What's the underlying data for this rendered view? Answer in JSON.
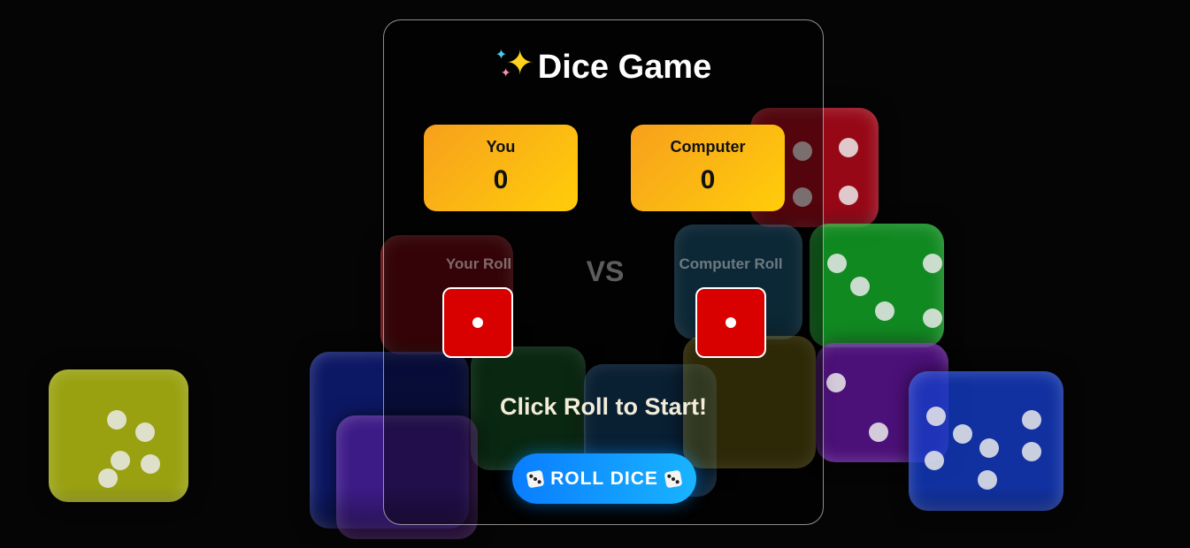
{
  "game": {
    "title": "Dice Game",
    "title_icon": "sparkles-icon",
    "players": [
      {
        "label": "You",
        "score": "0"
      },
      {
        "label": "Computer",
        "score": "0"
      }
    ],
    "rolls": {
      "player_label": "Your Roll",
      "vs_label": "VS",
      "computer_label": "Computer Roll",
      "player_die_value": 1,
      "computer_die_value": 1
    },
    "status_text": "Click Roll to Start!",
    "roll_button_label": "ROLL DICE",
    "roll_button_icon": "die-icon"
  },
  "colors": {
    "score_gradient_start": "#f7a01c",
    "score_gradient_end": "#ffcd0a",
    "die_face": "#d90000",
    "button_gradient_start": "#0a7dff",
    "button_gradient_end": "#19b4ff",
    "status_text": "#f2ecd8"
  }
}
